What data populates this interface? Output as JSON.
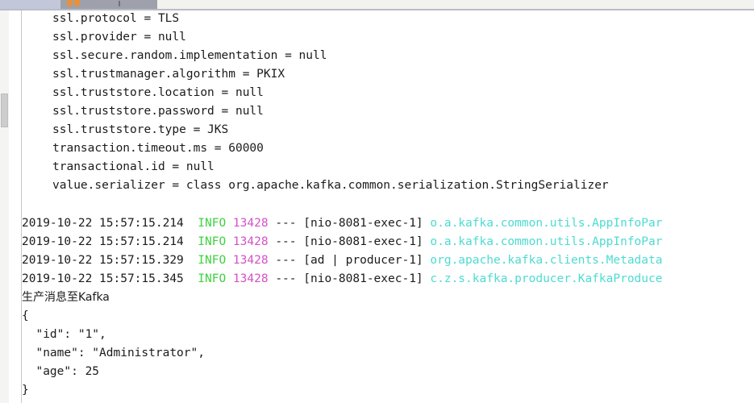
{
  "window": {
    "app": "IntelliJ IDEA Run Console",
    "tab_label": "",
    "tab_icon": "run-configuration-icon",
    "close_icon": "tab-close-icon"
  },
  "scrollbar": {
    "name": "vertical-scrollbar",
    "thumb": "scroll-thumb"
  },
  "console": {
    "config_lines": [
      "ssl.protocol = TLS",
      "ssl.provider = null",
      "ssl.secure.random.implementation = null",
      "ssl.trustmanager.algorithm = PKIX",
      "ssl.truststore.location = null",
      "ssl.truststore.password = null",
      "ssl.truststore.type = JKS",
      "transaction.timeout.ms = 60000",
      "transactional.id = null",
      "value.serializer = class org.apache.kafka.common.serialization.StringSerializer"
    ],
    "log_lines": [
      {
        "timestamp": "2019-10-22 15:57:15.214",
        "level": "INFO",
        "pid": "13428",
        "sep": "---",
        "thread": "[nio-8081-exec-1]",
        "logger": "o.a.kafka.common.utils.AppInfoPar"
      },
      {
        "timestamp": "2019-10-22 15:57:15.214",
        "level": "INFO",
        "pid": "13428",
        "sep": "---",
        "thread": "[nio-8081-exec-1]",
        "logger": "o.a.kafka.common.utils.AppInfoPar"
      },
      {
        "timestamp": "2019-10-22 15:57:15.329",
        "level": "INFO",
        "pid": "13428",
        "sep": "---",
        "thread": "[ad | producer-1]",
        "logger": "org.apache.kafka.clients.Metadata"
      },
      {
        "timestamp": "2019-10-22 15:57:15.345",
        "level": "INFO",
        "pid": "13428",
        "sep": "---",
        "thread": "[nio-8081-exec-1]",
        "logger": "c.z.s.kafka.producer.KafkaProduce"
      }
    ],
    "message_label": "生产消息至Kafka",
    "payload_lines": [
      "{",
      "  \"id\": \"1\",",
      "  \"name\": \"Administrator\",",
      "  \"age\": 25",
      "}"
    ]
  },
  "colors": {
    "level_info": "#3fd13f",
    "pid": "#d451c7",
    "logger": "#4ddbd1",
    "text": "#1b1b1b",
    "background": "#ffffff",
    "tab_selected": "#9ea1ab",
    "tab_icon": "#e8913a"
  }
}
